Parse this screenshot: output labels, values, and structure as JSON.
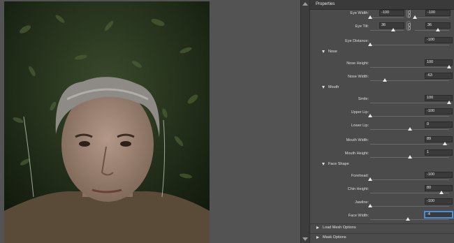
{
  "panel": {
    "title": "Properties"
  },
  "eye": {
    "width_label": "Eye Width:",
    "width_left": "-100",
    "width_right": "-100",
    "tilt_label": "Eye Tilt:",
    "tilt_left": "36",
    "tilt_right": "36",
    "distance_label": "Eye Distance:",
    "distance_value": "-100"
  },
  "nose": {
    "section_label": "Nose",
    "height_label": "Nose Height:",
    "height_value": "100",
    "width_label": "Nose Width:",
    "width_value": "-63"
  },
  "mouth": {
    "section_label": "Mouth",
    "smile_label": "Smile:",
    "smile_value": "100",
    "upper_lip_label": "Upper Lip:",
    "upper_lip_value": "-100",
    "lower_lip_label": "Lower Lip:",
    "lower_lip_value": "0",
    "width_label": "Mouth Width:",
    "width_value": "89",
    "height_label": "Mouth Height:",
    "height_value": "1"
  },
  "face_shape": {
    "section_label": "Face Shape",
    "forehead_label": "Forehead:",
    "forehead_value": "-100",
    "chin_height_label": "Chin Height:",
    "chin_height_value": "80",
    "jawline_label": "Jawline:",
    "jawline_value": "-100",
    "face_width_label": "Face Width:",
    "face_width_value": "-4"
  },
  "collapsed_sections": {
    "load_mesh_label": "Load Mesh Options",
    "mask_label": "Mask Options"
  },
  "slider_levels": {
    "eye_width": -100,
    "eye_tilt": 36,
    "eye_distance": -100,
    "nose_height": 100,
    "nose_width": -63,
    "smile": 100,
    "upper_lip": -100,
    "lower_lip": 0,
    "mouth_width": 89,
    "mouth_height": 1,
    "forehead": -100,
    "chin_height": 80,
    "jawline": -100,
    "face_width": -4
  },
  "colors": {
    "panel_bg": "#4b4b4b",
    "canvas_bg": "#535353",
    "focus": "#4a90e2"
  }
}
